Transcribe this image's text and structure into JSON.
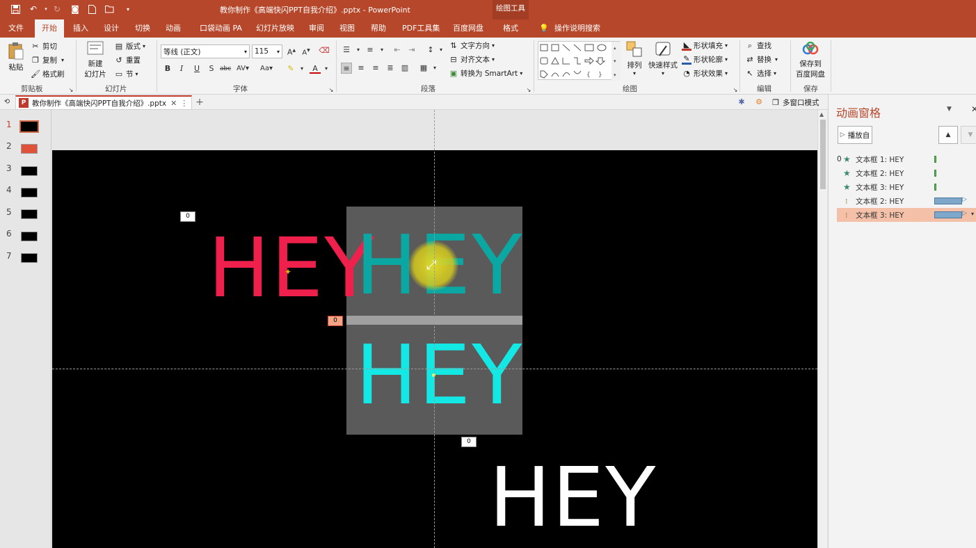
{
  "window": {
    "title": "教你制作《高端快闪PPT自我介绍》.pptx  -  PowerPoint",
    "context_tab": "绘图工具"
  },
  "tabs": [
    "文件",
    "开始",
    "插入",
    "设计",
    "切换",
    "动画",
    "口袋动画 PA",
    "幻灯片放映",
    "审阅",
    "视图",
    "帮助",
    "PDF工具集",
    "百度网盘",
    "格式"
  ],
  "search_label": "操作说明搜索",
  "ribbon": {
    "clipboard": {
      "paste": "粘贴",
      "cut": "剪切",
      "copy": "复制",
      "format_painter": "格式刷",
      "group": "剪贴板"
    },
    "slides": {
      "new_slide_line1": "新建",
      "new_slide_line2": "幻灯片",
      "layout": "版式",
      "reset": "重置",
      "section": "节",
      "group": "幻灯片"
    },
    "font": {
      "font_name": "等线 (正文)",
      "font_size": "115",
      "group": "字体"
    },
    "paragraph": {
      "text_direction": "文字方向",
      "align_text": "对齐文本",
      "smartart": "转换为 SmartArt",
      "group": "段落"
    },
    "drawing": {
      "arrange": "排列",
      "quick_styles": "快速样式",
      "fill": "形状填充",
      "outline": "形状轮廓",
      "effects": "形状效果",
      "group": "绘图"
    },
    "editing": {
      "find": "查找",
      "replace": "替换",
      "select": "选择",
      "group": "编辑"
    },
    "save": {
      "line1": "保存到",
      "line2": "百度网盘",
      "group": "保存"
    }
  },
  "doc_tab": {
    "name": "教你制作《高端快闪PPT自我介绍》.pptx",
    "multiwindow": "多窗口模式"
  },
  "thumbnails": [
    "1",
    "2",
    "3",
    "4",
    "5",
    "6",
    "7"
  ],
  "slide": {
    "red_text": "HEY",
    "teal_text": "HEY",
    "cyan_text": "HEY",
    "white_text": "HEY",
    "tag1": "0",
    "tag2": "0",
    "tag3": "0"
  },
  "anim_pane": {
    "title": "动画窗格",
    "play_from": "播放自",
    "items": [
      {
        "num": "0",
        "label": "文本框 1: HEY",
        "icon": "star",
        "type": "green"
      },
      {
        "num": "",
        "label": "文本框 2: HEY",
        "icon": "star",
        "type": "green"
      },
      {
        "num": "",
        "label": "文本框 3: HEY",
        "icon": "star",
        "type": "green"
      },
      {
        "num": "",
        "label": "文本框 2: HEY",
        "icon": "path",
        "type": "blue"
      },
      {
        "num": "",
        "label": "文本框 3: HEY",
        "icon": "path",
        "type": "blue"
      }
    ]
  },
  "colors": {
    "accent": "#b7472a",
    "red_hey": "#f0204d",
    "teal_hey": "#0aa7a3",
    "cyan_hey": "#13e8e5",
    "selected_row": "#f4c1a8"
  }
}
